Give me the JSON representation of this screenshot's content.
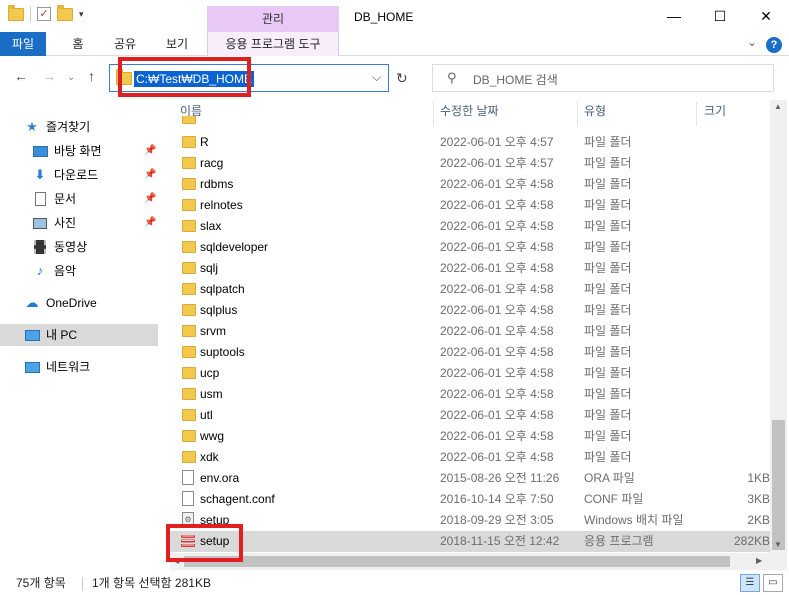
{
  "window": {
    "title": "DB_HOME",
    "context_tab_top": "관리",
    "minimize": "—",
    "maximize": "☐",
    "close": "✕"
  },
  "ribbon": {
    "tabs": [
      "파일",
      "홈",
      "공유",
      "보기",
      "응용 프로그램 도구"
    ],
    "help": "?"
  },
  "address": {
    "path": "C:₩Test₩DB_HOME",
    "search_placeholder": "DB_HOME 검색"
  },
  "nav": {
    "items": [
      {
        "label": "즐겨찾기",
        "icon": "star-icon",
        "pinned": false
      },
      {
        "label": "바탕 화면",
        "icon": "desktop-icon",
        "pinned": true
      },
      {
        "label": "다운로드",
        "icon": "download-icon",
        "pinned": true
      },
      {
        "label": "문서",
        "icon": "document-icon",
        "pinned": true
      },
      {
        "label": "사진",
        "icon": "picture-icon",
        "pinned": true
      },
      {
        "label": "동영상",
        "icon": "video-icon",
        "pinned": false
      },
      {
        "label": "음악",
        "icon": "music-icon",
        "pinned": false
      },
      {
        "label": "OneDrive",
        "icon": "cloud-icon",
        "pinned": false
      },
      {
        "label": "내 PC",
        "icon": "pc-icon",
        "pinned": false,
        "selected": true
      },
      {
        "label": "네트워크",
        "icon": "network-icon",
        "pinned": false
      }
    ]
  },
  "columns": {
    "name": "이름",
    "date": "수정한 날짜",
    "type": "유형",
    "size": "크기"
  },
  "files": [
    {
      "name": "R",
      "date": "2022-06-01 오후 4:57",
      "type": "파일 폴더",
      "size": "",
      "kind": "folder"
    },
    {
      "name": "racg",
      "date": "2022-06-01 오후 4:57",
      "type": "파일 폴더",
      "size": "",
      "kind": "folder"
    },
    {
      "name": "rdbms",
      "date": "2022-06-01 오후 4:58",
      "type": "파일 폴더",
      "size": "",
      "kind": "folder"
    },
    {
      "name": "relnotes",
      "date": "2022-06-01 오후 4:58",
      "type": "파일 폴더",
      "size": "",
      "kind": "folder"
    },
    {
      "name": "slax",
      "date": "2022-06-01 오후 4:58",
      "type": "파일 폴더",
      "size": "",
      "kind": "folder"
    },
    {
      "name": "sqldeveloper",
      "date": "2022-06-01 오후 4:58",
      "type": "파일 폴더",
      "size": "",
      "kind": "folder"
    },
    {
      "name": "sqlj",
      "date": "2022-06-01 오후 4:58",
      "type": "파일 폴더",
      "size": "",
      "kind": "folder"
    },
    {
      "name": "sqlpatch",
      "date": "2022-06-01 오후 4:58",
      "type": "파일 폴더",
      "size": "",
      "kind": "folder"
    },
    {
      "name": "sqlplus",
      "date": "2022-06-01 오후 4:58",
      "type": "파일 폴더",
      "size": "",
      "kind": "folder"
    },
    {
      "name": "srvm",
      "date": "2022-06-01 오후 4:58",
      "type": "파일 폴더",
      "size": "",
      "kind": "folder"
    },
    {
      "name": "suptools",
      "date": "2022-06-01 오후 4:58",
      "type": "파일 폴더",
      "size": "",
      "kind": "folder"
    },
    {
      "name": "ucp",
      "date": "2022-06-01 오후 4:58",
      "type": "파일 폴더",
      "size": "",
      "kind": "folder"
    },
    {
      "name": "usm",
      "date": "2022-06-01 오후 4:58",
      "type": "파일 폴더",
      "size": "",
      "kind": "folder"
    },
    {
      "name": "utl",
      "date": "2022-06-01 오후 4:58",
      "type": "파일 폴더",
      "size": "",
      "kind": "folder"
    },
    {
      "name": "wwg",
      "date": "2022-06-01 오후 4:58",
      "type": "파일 폴더",
      "size": "",
      "kind": "folder"
    },
    {
      "name": "xdk",
      "date": "2022-06-01 오후 4:58",
      "type": "파일 폴더",
      "size": "",
      "kind": "folder"
    },
    {
      "name": "env.ora",
      "date": "2015-08-26 오전 11:26",
      "type": "ORA 파일",
      "size": "1KB",
      "kind": "file"
    },
    {
      "name": "schagent.conf",
      "date": "2016-10-14 오후 7:50",
      "type": "CONF 파일",
      "size": "3KB",
      "kind": "file"
    },
    {
      "name": "setup",
      "date": "2018-09-29 오전 3:05",
      "type": "Windows 배치 파일",
      "size": "2KB",
      "kind": "batch"
    },
    {
      "name": "setup",
      "date": "2018-11-15 오전 12:42",
      "type": "응용 프로그램",
      "size": "282KB",
      "kind": "exe",
      "selected": true
    }
  ],
  "status": {
    "count": "75개 항목",
    "selection": "1개 항목 선택함 281KB"
  },
  "colors": {
    "accent": "#1a6ec6",
    "context_tab": "#e8c9f5",
    "highlight_box": "#e02020",
    "selection": "#d9d9d9"
  }
}
